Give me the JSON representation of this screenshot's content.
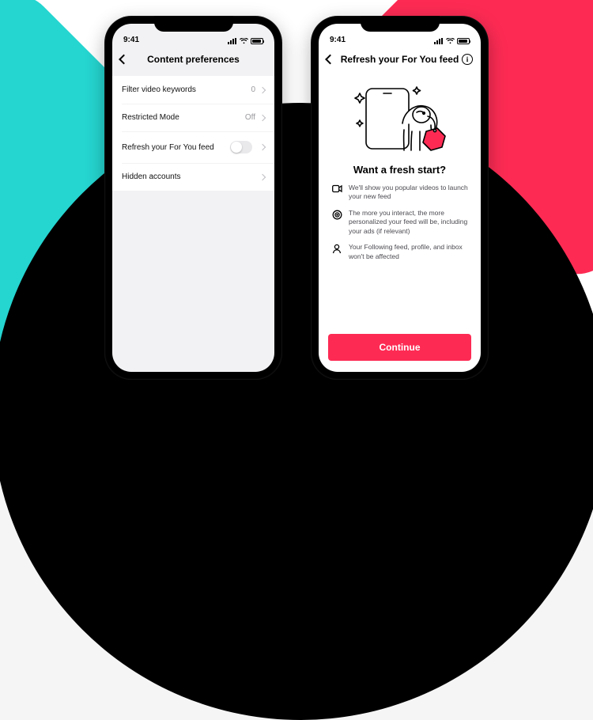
{
  "status": {
    "time": "9:41"
  },
  "phoneA": {
    "title": "Content preferences",
    "rows": {
      "filter": {
        "label": "Filter video keywords",
        "value": "0"
      },
      "restricted": {
        "label": "Restricted Mode",
        "value": "Off"
      },
      "refresh": {
        "label": "Refresh your For You feed"
      },
      "hidden": {
        "label": "Hidden accounts"
      }
    }
  },
  "phoneB": {
    "title": "Refresh your For You feed",
    "headline": "Want a fresh start?",
    "bullets": {
      "b1": "We'll show you popular videos to launch your new feed",
      "b2": "The more you interact, the more personalized your feed will be, including your ads (if relevant)",
      "b3": "Your Following feed, profile, and inbox won't be affected"
    },
    "cta": "Continue"
  }
}
